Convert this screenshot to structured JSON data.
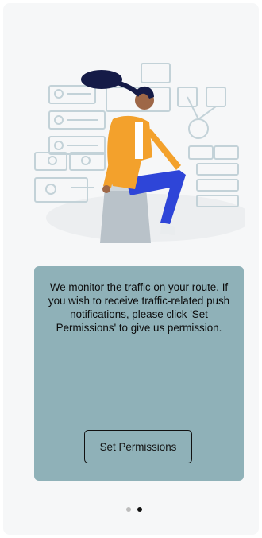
{
  "onboarding": {
    "message": "We monitor the traffic on your route. If you wish to receive traffic-related push notifications, please click 'Set Permissions' to give us permission.",
    "button_label": "Set Permissions"
  },
  "pager": {
    "total": 2,
    "active_index": 1
  },
  "colors": {
    "card_background": "#8fb1b8",
    "button_border": "#111111",
    "dot_inactive": "#bdbdbd",
    "dot_active": "#111111"
  },
  "illustration": {
    "icon": "person-sitting-with-feedback-screens-illustration"
  }
}
